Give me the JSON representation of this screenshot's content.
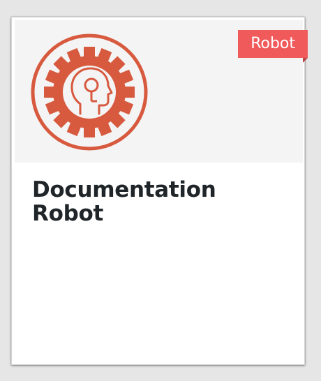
{
  "card": {
    "badge": "Robot",
    "title": "Documentation Robot",
    "logo_icon": "gear-robot-head-icon",
    "colors": {
      "logo": "#d75a3f",
      "badge": "#f05a5b",
      "title": "#1f2528",
      "media_background": "#f4f4f4"
    }
  }
}
